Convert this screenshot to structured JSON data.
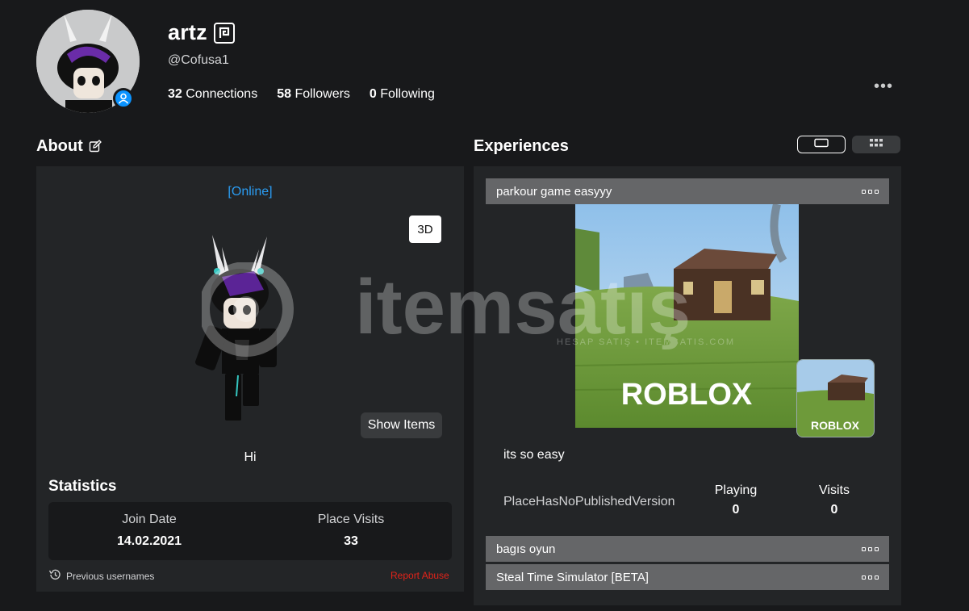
{
  "profile": {
    "display_name": "artz",
    "username": "@Cofusa1",
    "connections_count": "32",
    "connections_label": "Connections",
    "followers_count": "58",
    "followers_label": "Followers",
    "following_count": "0",
    "following_label": "Following",
    "more_label": "•••"
  },
  "about": {
    "title": "About",
    "status": "[Online]",
    "btn_3d": "3D",
    "show_items": "Show Items",
    "bio": "Hi",
    "statistics_title": "Statistics",
    "join_date_label": "Join Date",
    "join_date_value": "14.02.2021",
    "place_visits_label": "Place Visits",
    "place_visits_value": "33",
    "previous_usernames": "Previous usernames",
    "report_abuse": "Report Abuse"
  },
  "experiences": {
    "title": "Experiences",
    "items": [
      {
        "name": "parkour game easyyy",
        "description": "its so easy",
        "status": "PlaceHasNoPublishedVersion",
        "playing_label": "Playing",
        "playing_value": "0",
        "visits_label": "Visits",
        "visits_value": "0"
      },
      {
        "name": "bagıs oyun"
      },
      {
        "name": "Steal Time Simulator [BETA]"
      }
    ],
    "thumbnail_brand": "ROBLOX"
  },
  "watermark": {
    "brand": "itemsatış",
    "tagline": "HESAP SATIŞ • ITEMSATIS.COM"
  },
  "colors": {
    "background": "#18191b",
    "panel": "#232527",
    "accent_blue": "#0b93ff",
    "online_blue": "#2a9cf2",
    "report_red": "#e2231a",
    "bar_gray": "#656668"
  }
}
